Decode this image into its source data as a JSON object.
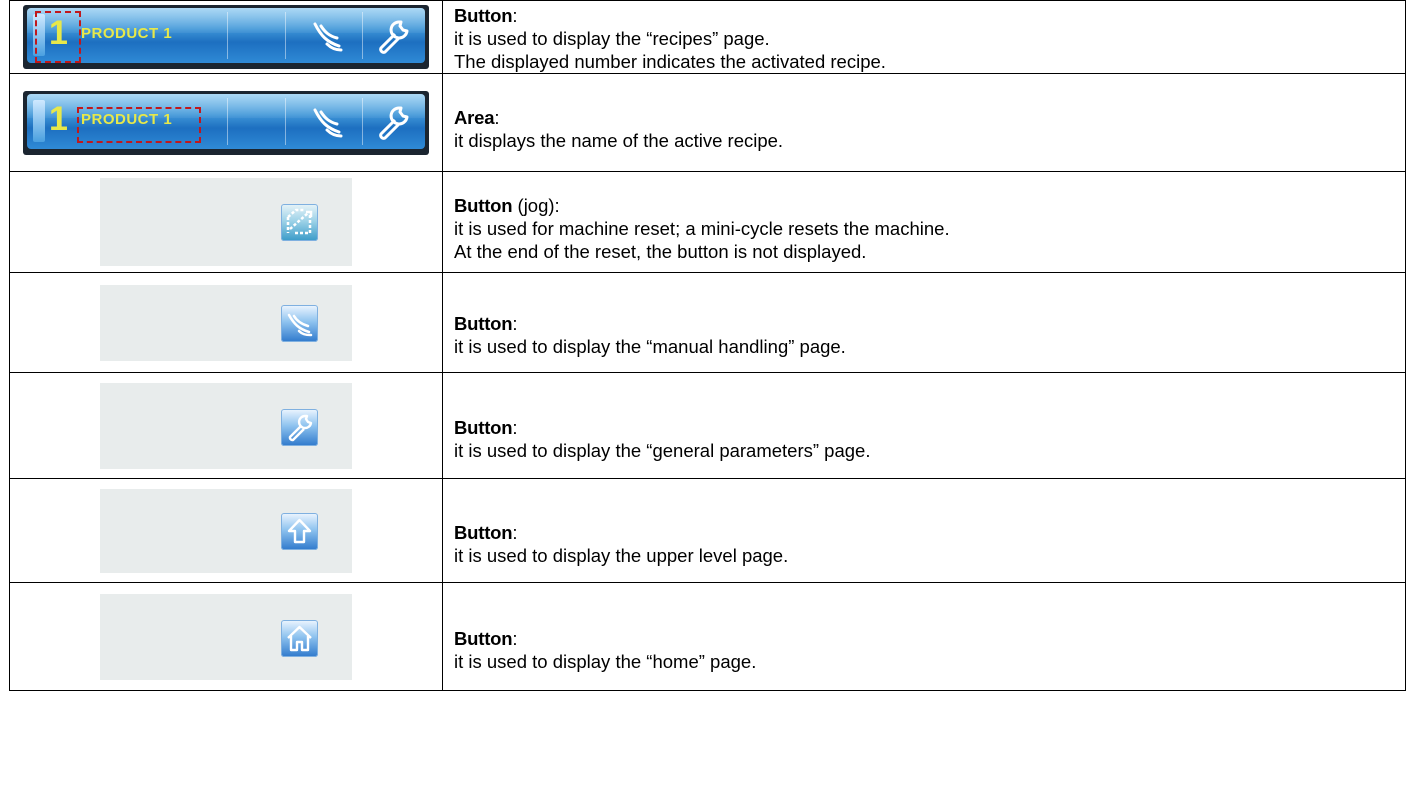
{
  "toolbar_image": {
    "recipe_number": "1",
    "recipe_name": "PRODUCT 1"
  },
  "rows": [
    {
      "title": "Button",
      "qualifier": "",
      "lines": [
        "it is used to display the “recipes” page.",
        "The displayed number indicates the activated recipe."
      ],
      "icon": "recipe-number-toolbar-icon"
    },
    {
      "title": "Area",
      "qualifier": "",
      "lines": [
        "it displays the name of the active recipe."
      ],
      "icon": "recipe-name-toolbar-icon"
    },
    {
      "title": "Button",
      "qualifier": " (jog)",
      "lines": [
        "it is used for machine reset; a mini-cycle resets the machine.",
        "At the end of the reset, the button is not displayed."
      ],
      "icon": "reset-icon"
    },
    {
      "title": "Button",
      "qualifier": "",
      "lines": [
        "it is used to display the “manual handling” page."
      ],
      "icon": "hand-icon"
    },
    {
      "title": "Button",
      "qualifier": "",
      "lines": [
        "it is used to display the “general parameters” page."
      ],
      "icon": "wrench-icon"
    },
    {
      "title": "Button",
      "qualifier": "",
      "lines": [
        "it is used to display the upper level page."
      ],
      "icon": "arrow-up-icon"
    },
    {
      "title": "Button",
      "qualifier": "",
      "lines": [
        "it is used to display the “home” page."
      ],
      "icon": "home-icon"
    }
  ],
  "colors": {
    "highlight": "#c0181c",
    "toolbar_text": "#e7e84a",
    "button_blue": "#2f79cc",
    "panel_grey": "#e8ecec"
  }
}
